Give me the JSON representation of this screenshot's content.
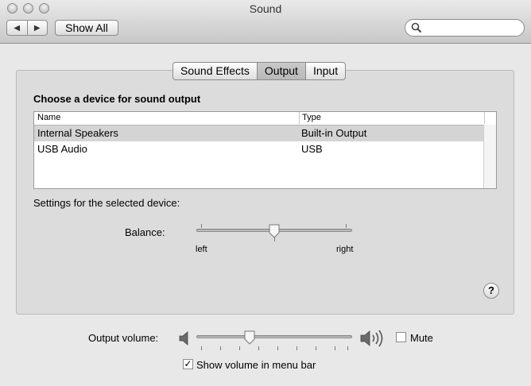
{
  "window": {
    "title": "Sound"
  },
  "toolbar": {
    "back_icon": "triangle-left",
    "forward_icon": "triangle-right",
    "show_all_label": "Show All",
    "search_placeholder": ""
  },
  "tabs": [
    {
      "label": "Sound Effects",
      "selected": false
    },
    {
      "label": "Output",
      "selected": true
    },
    {
      "label": "Input",
      "selected": false
    }
  ],
  "output": {
    "heading": "Choose a device for sound output",
    "columns": [
      "Name",
      "Type"
    ],
    "devices": [
      {
        "name": "Internal Speakers",
        "type": "Built-in Output",
        "selected": true
      },
      {
        "name": "USB Audio",
        "type": "USB",
        "selected": false
      }
    ],
    "settings_label": "Settings for the selected device:",
    "balance": {
      "label": "Balance:",
      "left": "left",
      "right": "right",
      "value": 0.5
    }
  },
  "volume": {
    "label": "Output volume:",
    "value": 0.33,
    "mute_label": "Mute",
    "mute_checked": false,
    "menubar_label": "Show volume in menu bar",
    "menubar_checked": true,
    "check_glyph": "✓"
  },
  "help": {
    "label": "?"
  },
  "colors": {
    "selected_row": "#d4d4d4",
    "panel": "#dcdcdc"
  }
}
